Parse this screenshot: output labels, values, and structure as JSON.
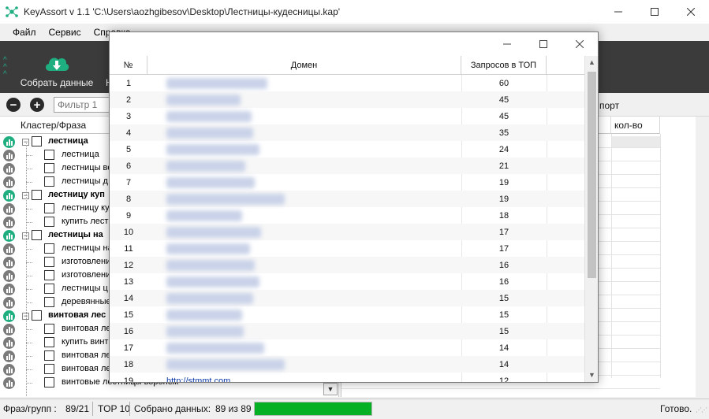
{
  "window": {
    "title": "KeyAssort v 1.1  'C:\\Users\\aozhgibesov\\Desktop\\Лестницы-кудесницы.kap'"
  },
  "menu": [
    "Файл",
    "Сервис",
    "Справка"
  ],
  "toolbar": {
    "collect_label": "Собрать данные",
    "next_label": "Н"
  },
  "filter": {
    "placeholder": "Фильтр 1",
    "export_label": "порт"
  },
  "tree": {
    "header": "Кластер/Фраза",
    "rows": [
      {
        "text": "лестница",
        "level": 0,
        "bold": true,
        "icon": "green"
      },
      {
        "text": "лестница",
        "level": 1,
        "bold": false,
        "icon": "gray"
      },
      {
        "text": "лестницы ве",
        "level": 1,
        "bold": false,
        "icon": "gray"
      },
      {
        "text": "лестницы д",
        "level": 1,
        "bold": false,
        "icon": "gray"
      },
      {
        "text": "лестницу куп",
        "level": 0,
        "bold": true,
        "icon": "green"
      },
      {
        "text": "лестницу ку",
        "level": 1,
        "bold": false,
        "icon": "gray"
      },
      {
        "text": "купить лест",
        "level": 1,
        "bold": false,
        "icon": "gray"
      },
      {
        "text": "лестницы на",
        "level": 0,
        "bold": true,
        "icon": "green"
      },
      {
        "text": "лестницы на",
        "level": 1,
        "bold": false,
        "icon": "gray"
      },
      {
        "text": "изготовлени",
        "level": 1,
        "bold": false,
        "icon": "gray"
      },
      {
        "text": "изготовлени",
        "level": 1,
        "bold": false,
        "icon": "gray"
      },
      {
        "text": "лестницы ц",
        "level": 1,
        "bold": false,
        "icon": "gray"
      },
      {
        "text": "деревянные",
        "level": 1,
        "bold": false,
        "icon": "gray"
      },
      {
        "text": "винтовая лес",
        "level": 0,
        "bold": true,
        "icon": "green"
      },
      {
        "text": "винтовая ле",
        "level": 1,
        "bold": false,
        "icon": "gray"
      },
      {
        "text": "купить винт",
        "level": 1,
        "bold": false,
        "icon": "gray"
      },
      {
        "text": "винтовая ле",
        "level": 1,
        "bold": false,
        "icon": "gray"
      },
      {
        "text": "винтовая ле",
        "level": 1,
        "bold": false,
        "icon": "gray"
      },
      {
        "text": "винтовые лестницы воронеж",
        "level": 1,
        "bold": false,
        "icon": "gray"
      }
    ]
  },
  "right_panel": {
    "qty_header": "кол-во"
  },
  "status": {
    "phrases_label": "Фраз/групп :",
    "phrases_value": "89/21",
    "top_label": "TOP 10",
    "collected_label": "Собрано данных:",
    "collected_value": "89 из 89",
    "progress": 1.0,
    "progress_color": "#06b025",
    "ready": "Готово."
  },
  "dialog": {
    "columns": [
      "№",
      "Домен",
      "Запросов в ТОП"
    ],
    "rows": [
      {
        "n": "1",
        "count": "60"
      },
      {
        "n": "2",
        "count": "45"
      },
      {
        "n": "3",
        "count": "45"
      },
      {
        "n": "4",
        "count": "35"
      },
      {
        "n": "5",
        "count": "24"
      },
      {
        "n": "6",
        "count": "21"
      },
      {
        "n": "7",
        "count": "19"
      },
      {
        "n": "8",
        "count": "19"
      },
      {
        "n": "9",
        "count": "18"
      },
      {
        "n": "10",
        "count": "17"
      },
      {
        "n": "11",
        "count": "17"
      },
      {
        "n": "12",
        "count": "16"
      },
      {
        "n": "13",
        "count": "16"
      },
      {
        "n": "14",
        "count": "15"
      },
      {
        "n": "15",
        "count": "15"
      },
      {
        "n": "16",
        "count": "15"
      },
      {
        "n": "17",
        "count": "14"
      },
      {
        "n": "18",
        "count": "14"
      },
      {
        "n": "19",
        "count": "12",
        "domain": "http://stmmt.com"
      }
    ]
  },
  "colors": {
    "toolbar_bg": "#3b3b3b",
    "accent_green": "#1fae80",
    "link_blue": "#0b39a8"
  }
}
